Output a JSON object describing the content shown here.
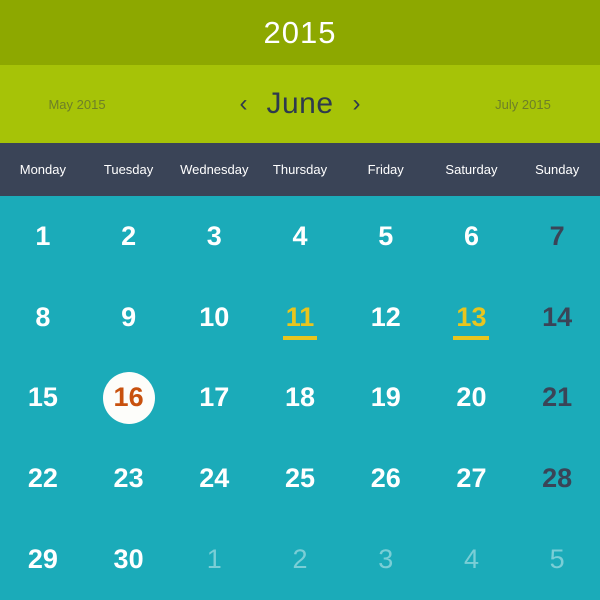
{
  "colors": {
    "year_band": "#8DA800",
    "month_band": "#A6C307",
    "weekday_band": "#3A4457",
    "grid_background": "#1BABB9",
    "event_accent": "#E8C51E",
    "today_text": "#C8510E",
    "today_circle": "#FDFDFA",
    "sunday_text": "#3A4457",
    "muted_text": "rgba(255,255,255,0.42)"
  },
  "header": {
    "year": "2015"
  },
  "nav": {
    "prev_month_label": "May 2015",
    "next_month_label": "July 2015",
    "current_month": "June",
    "prev_arrow": "‹",
    "next_arrow": "›"
  },
  "weekdays": [
    "Monday",
    "Tuesday",
    "Wednesday",
    "Thursday",
    "Friday",
    "Saturday",
    "Sunday"
  ],
  "grid": {
    "rows": [
      [
        {
          "day": "1",
          "state": "normal"
        },
        {
          "day": "2",
          "state": "normal"
        },
        {
          "day": "3",
          "state": "normal"
        },
        {
          "day": "4",
          "state": "normal"
        },
        {
          "day": "5",
          "state": "normal"
        },
        {
          "day": "6",
          "state": "normal"
        },
        {
          "day": "7",
          "state": "sunday"
        }
      ],
      [
        {
          "day": "8",
          "state": "normal"
        },
        {
          "day": "9",
          "state": "normal"
        },
        {
          "day": "10",
          "state": "normal"
        },
        {
          "day": "11",
          "state": "event"
        },
        {
          "day": "12",
          "state": "normal"
        },
        {
          "day": "13",
          "state": "event"
        },
        {
          "day": "14",
          "state": "sunday"
        }
      ],
      [
        {
          "day": "15",
          "state": "normal"
        },
        {
          "day": "16",
          "state": "today"
        },
        {
          "day": "17",
          "state": "normal"
        },
        {
          "day": "18",
          "state": "normal"
        },
        {
          "day": "19",
          "state": "normal"
        },
        {
          "day": "20",
          "state": "normal"
        },
        {
          "day": "21",
          "state": "sunday"
        }
      ],
      [
        {
          "day": "22",
          "state": "normal"
        },
        {
          "day": "23",
          "state": "normal"
        },
        {
          "day": "24",
          "state": "normal"
        },
        {
          "day": "25",
          "state": "normal"
        },
        {
          "day": "26",
          "state": "normal"
        },
        {
          "day": "27",
          "state": "normal"
        },
        {
          "day": "28",
          "state": "sunday"
        }
      ],
      [
        {
          "day": "29",
          "state": "normal"
        },
        {
          "day": "30",
          "state": "normal"
        },
        {
          "day": "1",
          "state": "muted"
        },
        {
          "day": "2",
          "state": "muted"
        },
        {
          "day": "3",
          "state": "muted"
        },
        {
          "day": "4",
          "state": "muted"
        },
        {
          "day": "5",
          "state": "muted"
        }
      ]
    ]
  }
}
